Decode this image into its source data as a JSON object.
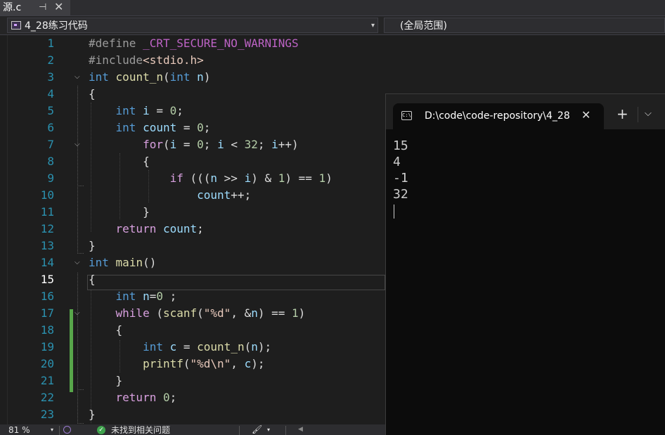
{
  "file_tab": {
    "name": "源.c",
    "pin": "⊣",
    "close": "✕"
  },
  "navbar": {
    "project": "4_28练习代码",
    "scope": "(全局范围)",
    "dropdown_arrow": "▾"
  },
  "editor": {
    "current_line": 15,
    "line_numbers": [
      "1",
      "2",
      "3",
      "4",
      "5",
      "6",
      "7",
      "8",
      "9",
      "10",
      "11",
      "12",
      "13",
      "14",
      "15",
      "16",
      "17",
      "18",
      "19",
      "20",
      "21",
      "22",
      "23"
    ]
  },
  "terminal": {
    "icon_text": "C:\\",
    "tab_title": "D:\\code\\code-repository\\4_28",
    "close": "✕",
    "new_tab": "+",
    "menu": "⌵",
    "output": [
      "15",
      "4",
      "-1",
      "32"
    ]
  },
  "statusbar": {
    "zoom": "81 %",
    "zoom_arrow": "▾",
    "ok_icon": "✓",
    "issues": "未找到相关问题",
    "brush_arrow": "▾",
    "left_arrow": "◀"
  },
  "colors": {
    "keyword": "#569cd6",
    "control": "#d8a0df",
    "number": "#b5cea8",
    "string": "#e8c9bb",
    "macro": "#bd63c5",
    "function": "#dcdcaa",
    "variable": "#9cdcfe",
    "line_number": "#2b91af",
    "change_bar": "#57a64a"
  }
}
